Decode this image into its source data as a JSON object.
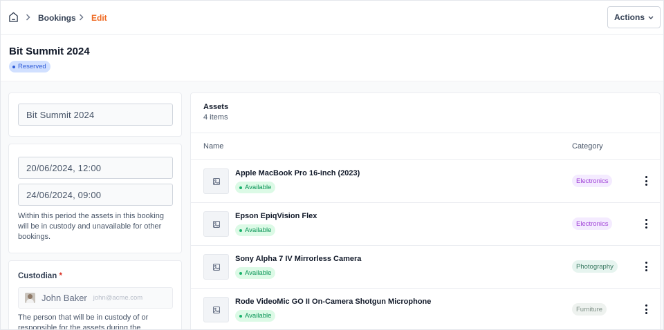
{
  "breadcrumb": {
    "home_icon": "home-icon",
    "items": [
      "Bookings",
      "Edit"
    ],
    "active_color": "#ef6820"
  },
  "header": {
    "actions_label": "Actions",
    "title": "Bit Summit 2024",
    "status_badge": "Reserved"
  },
  "form": {
    "name_value": "Bit Summit 2024",
    "start_date": "20/06/2024, 12:00",
    "end_date": "24/06/2024, 09:00",
    "dates_help": "Within this period the assets in this booking will be in custody and unavailable for other bookings.",
    "custodian_label": "Custodian",
    "required_mark": "*",
    "custodian_name": "John Baker",
    "custodian_email": "john@acme.com",
    "custodian_help": "The person that will be in custody of or responsible for the assets during the"
  },
  "assets": {
    "title": "Assets",
    "count_text": "4 items",
    "columns": [
      "Name",
      "Category"
    ],
    "rows": [
      {
        "name": "Apple MacBook Pro 16-inch (2023)",
        "status": "Available",
        "category": "Electronics",
        "cat_bg": "#f4ebff",
        "cat_fg": "#9e3fd6"
      },
      {
        "name": "Epson EpiqVision Flex",
        "status": "Available",
        "category": "Electronics",
        "cat_bg": "#f4ebff",
        "cat_fg": "#9e3fd6"
      },
      {
        "name": "Sony Alpha 7 IV Mirrorless Camera",
        "status": "Available",
        "category": "Photography",
        "cat_bg": "#e6f4ef",
        "cat_fg": "#3b7a63"
      },
      {
        "name": "Rode VideoMic GO II On-Camera Shotgun Microphone",
        "status": "Available",
        "category": "Furniture",
        "cat_bg": "#eef2ef",
        "cat_fg": "#7d8f86"
      }
    ]
  },
  "colors": {
    "reserved_bg": "#d1e0ff",
    "reserved_fg": "#2e5bd8",
    "available_bg": "#dcfae6",
    "available_fg": "#079455"
  }
}
